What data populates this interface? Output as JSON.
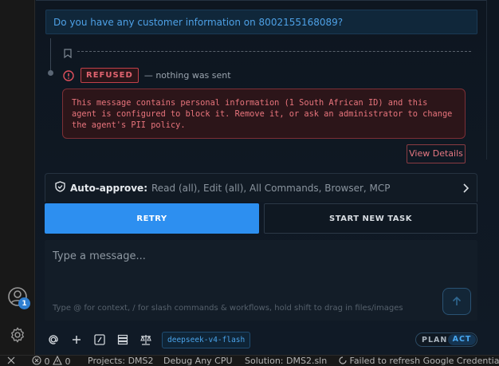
{
  "chat": {
    "user_message": "Do you have any customer information on 8002155168089?",
    "refused_badge": "REFUSED",
    "refused_note": "— nothing was sent",
    "pii_message": "This message contains personal information (1 South African ID) and this agent is configured to block it. Remove it, or ask an administrator to change the agent's PII policy.",
    "view_details_label": "View Details"
  },
  "auto_approve": {
    "label": "Auto-approve:",
    "values": "Read (all), Edit (all), All Commands, Browser, MCP"
  },
  "actions": {
    "retry_label": "RETRY",
    "new_task_label": "START NEW TASK"
  },
  "composer": {
    "placeholder": "Type a message...",
    "hint": "Type @ for context, / for slash commands & workflows, hold shift to drag in files/images"
  },
  "toolbar": {
    "model": "deepseek-v4-flash",
    "mode_plan": "PLAN",
    "mode_act": "ACT",
    "active_mode": "ACT"
  },
  "activity_bar": {
    "account_badge": "1"
  },
  "status_bar": {
    "errors": "0",
    "warnings": "0",
    "project": "Projects: DMS2",
    "config": "Debug Any CPU",
    "solution": "Solution: DMS2.sln",
    "message": "Failed to refresh Google Credential"
  },
  "colors": {
    "accent": "#2d8ff0",
    "danger": "#c2414a",
    "link": "#4ea1e6"
  }
}
